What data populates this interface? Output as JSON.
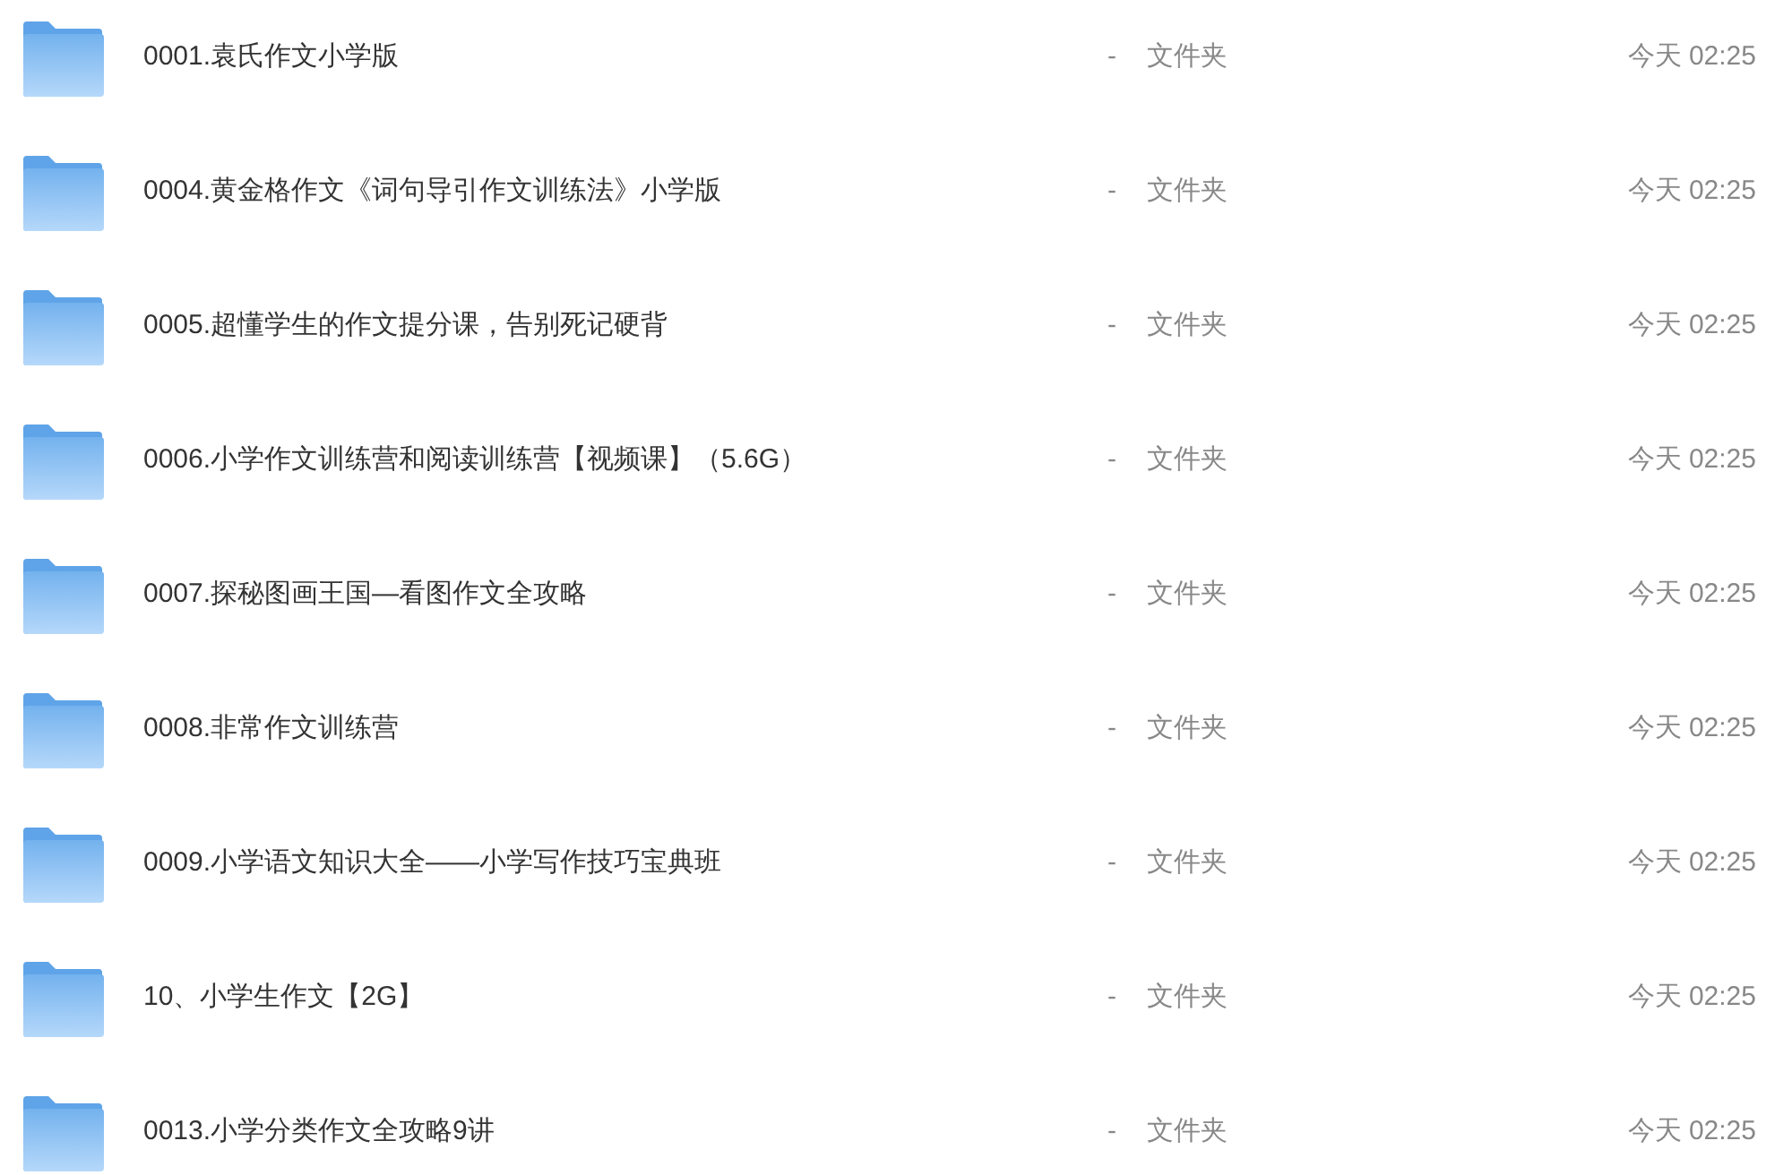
{
  "files": [
    {
      "name": "0001.袁氏作文小学版",
      "size": "-",
      "type": "文件夹",
      "modified": "今天 02:25"
    },
    {
      "name": "0004.黄金格作文《词句导引作文训练法》小学版",
      "size": "-",
      "type": "文件夹",
      "modified": "今天 02:25"
    },
    {
      "name": "0005.超懂学生的作文提分课，告别死记硬背",
      "size": "-",
      "type": "文件夹",
      "modified": "今天 02:25"
    },
    {
      "name": "0006.小学作文训练营和阅读训练营【视频课】（5.6G）",
      "size": "-",
      "type": "文件夹",
      "modified": "今天 02:25"
    },
    {
      "name": "0007.探秘图画王国—看图作文全攻略",
      "size": "-",
      "type": "文件夹",
      "modified": "今天 02:25"
    },
    {
      "name": "0008.非常作文训练营",
      "size": "-",
      "type": "文件夹",
      "modified": "今天 02:25"
    },
    {
      "name": "0009.小学语文知识大全——小学写作技巧宝典班",
      "size": "-",
      "type": "文件夹",
      "modified": "今天 02:25"
    },
    {
      "name": "10、小学生作文【2G】",
      "size": "-",
      "type": "文件夹",
      "modified": "今天 02:25"
    },
    {
      "name": "0013.小学分类作文全攻略9讲",
      "size": "-",
      "type": "文件夹",
      "modified": "今天 02:25"
    }
  ]
}
